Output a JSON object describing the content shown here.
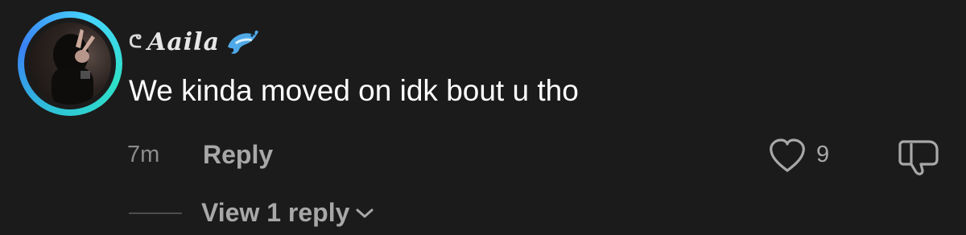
{
  "comment": {
    "username": "Aaila",
    "username_prefix": "ᕦ",
    "badge_icon": "dolphin-emoji-icon",
    "text": "We kinda moved on idk bout u tho",
    "time": "7m",
    "reply_label": "Reply",
    "like_count": "9",
    "view_replies_label": "View 1 reply"
  },
  "icons": {
    "like": "heart-outline-icon",
    "dislike": "thumbs-down-outline-icon",
    "chevron": "chevron-down-icon"
  },
  "colors": {
    "background": "#1b1b1b",
    "ring_start": "#2ec4d6",
    "ring_end": "#3b82f6",
    "muted_text": "#a8a8a8",
    "time_text": "#8c8c8c"
  }
}
